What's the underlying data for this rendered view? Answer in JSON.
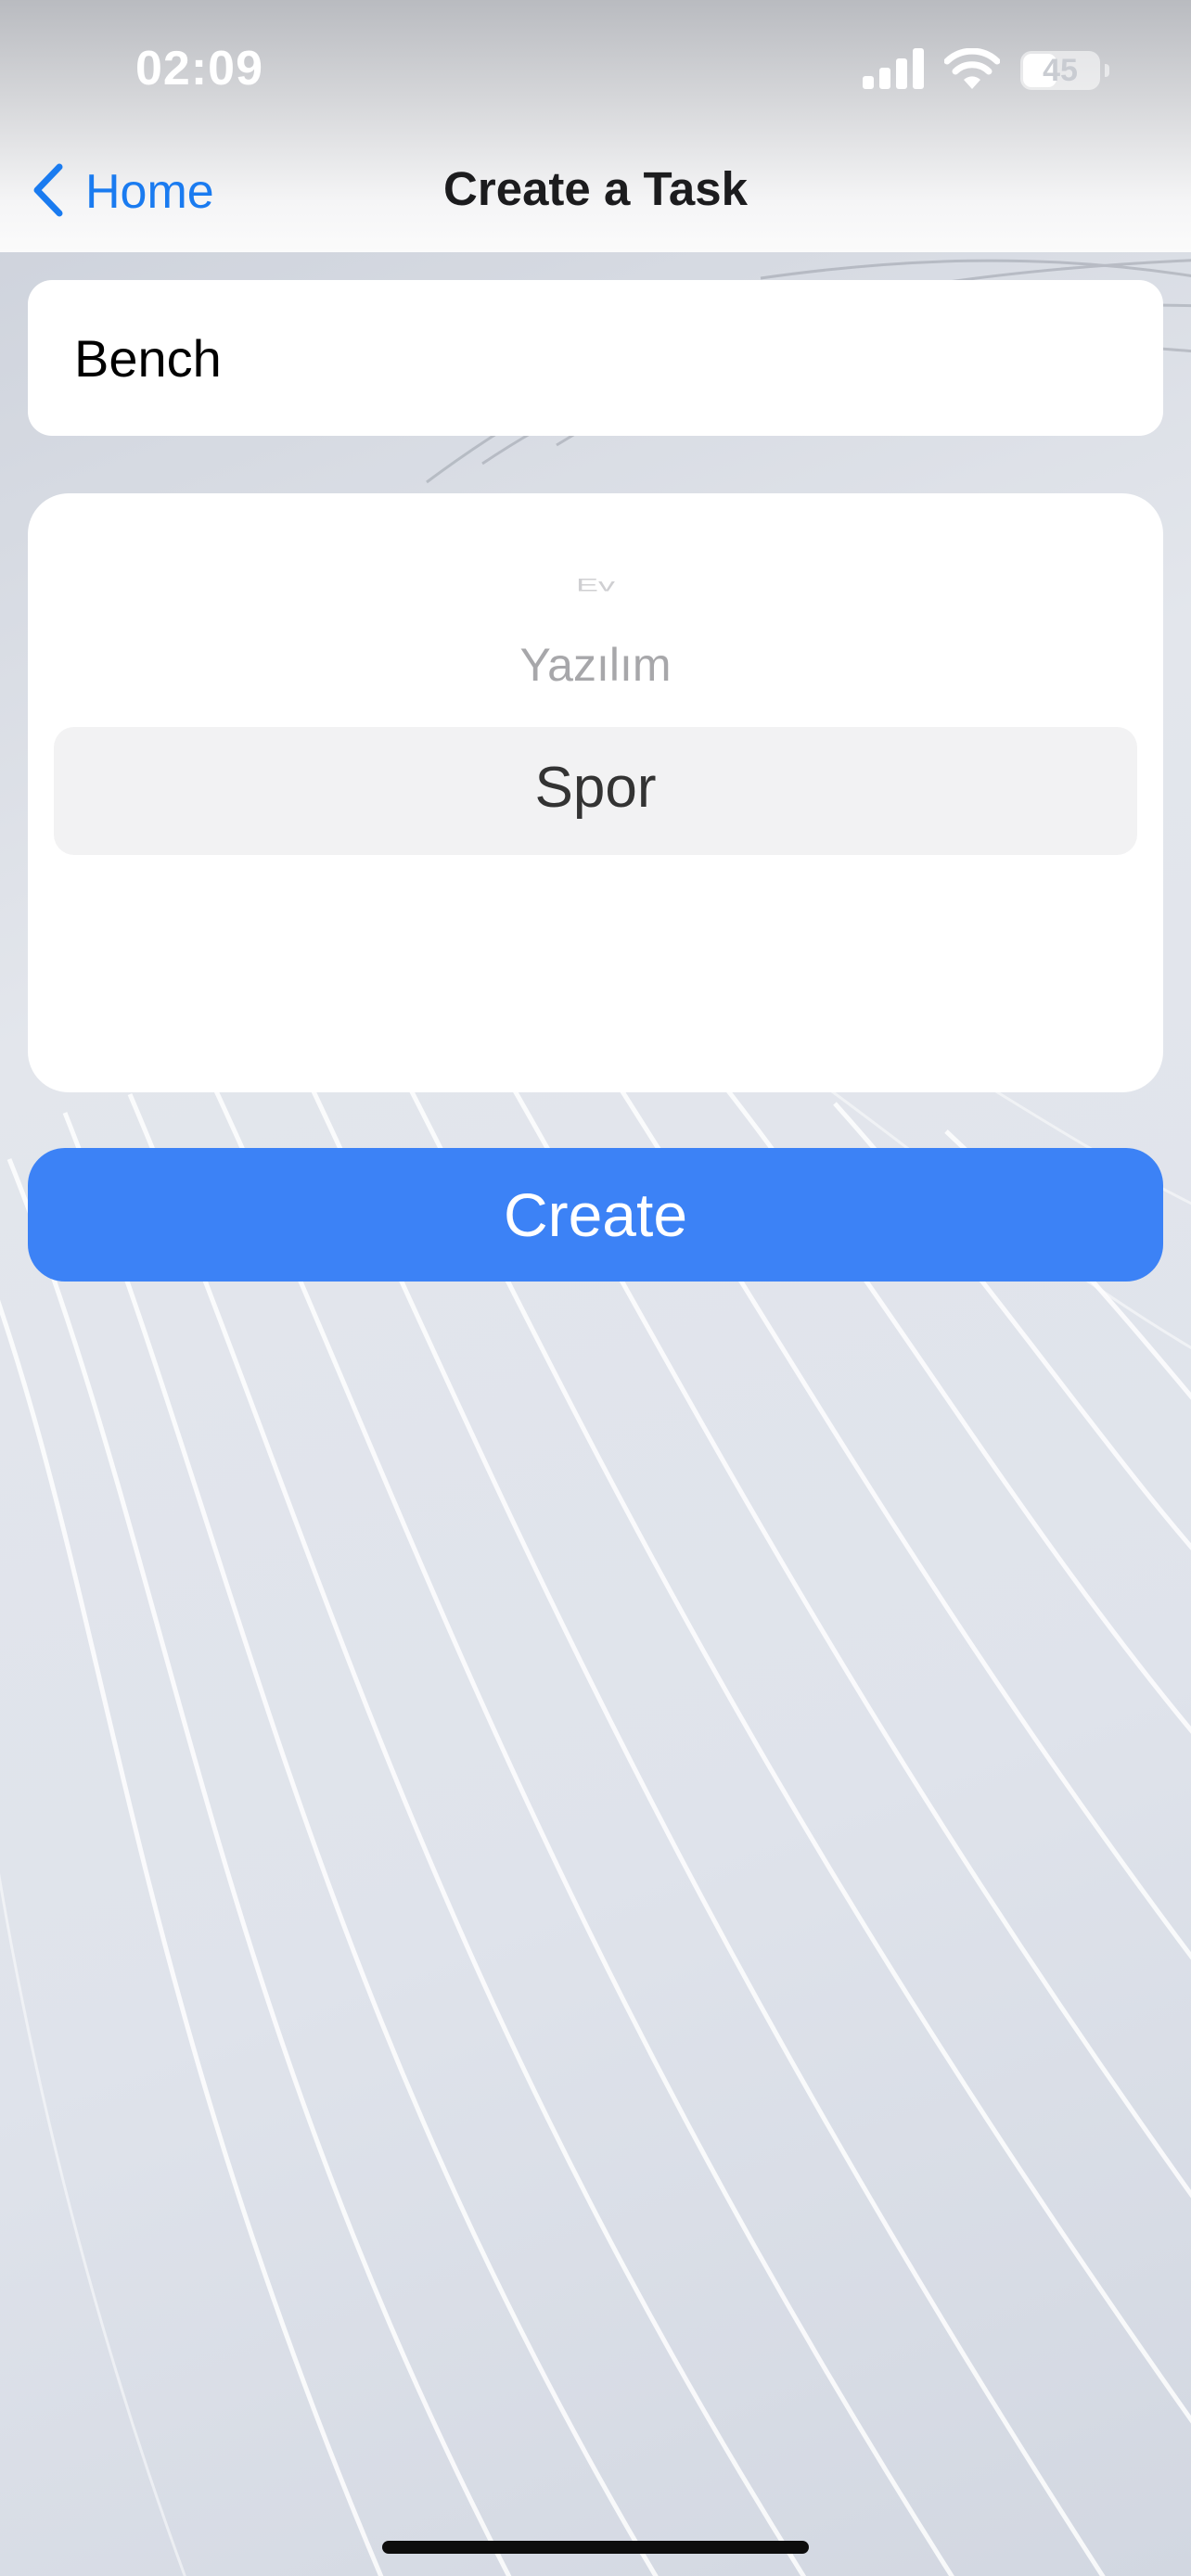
{
  "status_bar": {
    "time": "02:09",
    "battery_level": "45",
    "icons": [
      "cellular-signal-icon",
      "wifi-icon",
      "battery-icon"
    ]
  },
  "nav": {
    "back_label": "Home",
    "title": "Create a Task"
  },
  "form": {
    "task_name_value": "Bench",
    "picker": {
      "visible_options": [
        "Ev",
        "Yazılım",
        "Spor"
      ],
      "selected": "Spor"
    },
    "create_label": "Create"
  },
  "colors": {
    "accent": "#1a7bf0",
    "button": "#3c82f6"
  }
}
